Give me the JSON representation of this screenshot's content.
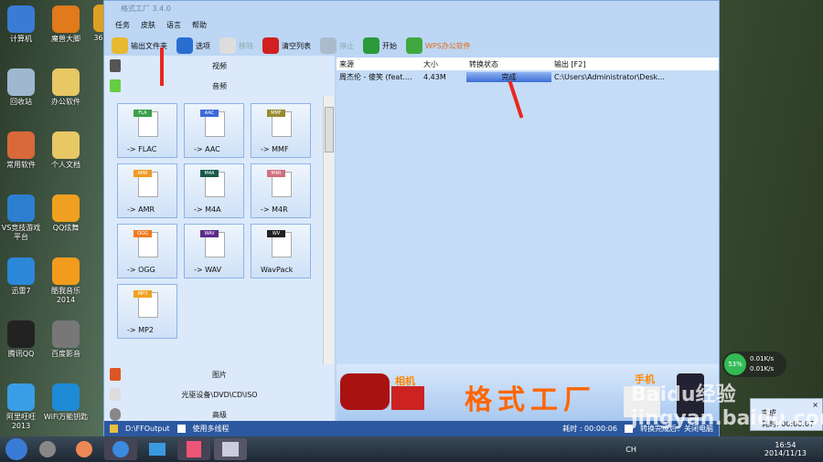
{
  "desktop": {
    "icons": [
      {
        "label": "计算机",
        "color": "#3a7bd5"
      },
      {
        "label": "魔兽大脚",
        "color": "#e07a1a"
      },
      {
        "label": "回收站",
        "color": "#9fb8d0"
      },
      {
        "label": "办公软件",
        "color": "#e8c765"
      },
      {
        "label": "常用软件",
        "color": "#d9683a"
      },
      {
        "label": "个人文档",
        "color": "#e8c765"
      },
      {
        "label": "VS竞技游戏平台",
        "color": "#2c7fcf"
      },
      {
        "label": "QQ炫舞",
        "color": "#f0a020"
      },
      {
        "label": "迅雷7",
        "color": "#2b87d8"
      },
      {
        "label": "酷我音乐2014",
        "color": "#f29b1d"
      },
      {
        "label": "腾讯QQ",
        "color": "#222222"
      },
      {
        "label": "百度影音",
        "color": "#777777"
      },
      {
        "label": "阿里旺旺2013",
        "color": "#3a9ee6"
      },
      {
        "label": "WiFi万能钥匙",
        "color": "#1e8bd6"
      }
    ],
    "partial_label": "360"
  },
  "window": {
    "title": "格式工厂 3.4.0",
    "menu": [
      "任务",
      "皮肤",
      "语言",
      "帮助"
    ],
    "toolbar": [
      {
        "label": "输出文件夹",
        "color": "#e8b830"
      },
      {
        "label": "选项",
        "color": "#2a6ed0"
      },
      {
        "label": "移除",
        "color": "#dddddd"
      },
      {
        "label": "清空列表",
        "color": "#d02020"
      },
      {
        "label": "停止",
        "color": "#aabbcc"
      },
      {
        "label": "开始",
        "color": "#2a9a3a"
      },
      {
        "label": "WPS办公软件",
        "color": "#3ea83e"
      }
    ],
    "categories_top": [
      "视频",
      "音频"
    ],
    "formats": [
      {
        "tag": "FLA",
        "label": "-> FLAC",
        "color": "#3aa04a"
      },
      {
        "tag": "AAC",
        "label": "-> AAC",
        "color": "#3a6ad8"
      },
      {
        "tag": "MMF",
        "label": "-> MMF",
        "color": "#9a8a30"
      },
      {
        "tag": "AMR",
        "label": "-> AMR",
        "color": "#f09a20"
      },
      {
        "tag": "M4A",
        "label": "-> M4A",
        "color": "#1a5a4a"
      },
      {
        "tag": "M4R",
        "label": "-> M4R",
        "color": "#d07080"
      },
      {
        "tag": "OGG",
        "label": "-> OGG",
        "color": "#f07a20"
      },
      {
        "tag": "WAV",
        "label": "-> WAV",
        "color": "#5a2a8a"
      },
      {
        "tag": "WV",
        "label": "WavPack",
        "color": "#222222"
      },
      {
        "tag": "MP3",
        "label": "-> MP2",
        "color": "#f0a020"
      }
    ],
    "categories_bottom": [
      "图片",
      "光驱设备\\DVD\\CD\\ISO",
      "高级"
    ],
    "table": {
      "headers": [
        "来源",
        "大小",
        "转换状态",
        "输出 [F2]"
      ],
      "rows": [
        {
          "source": "周杰伦 - 傻笑 (feat....",
          "size": "4.43M",
          "status": "完成",
          "output": "C:\\Users\\Administrator\\Desk..."
        }
      ]
    },
    "banner": {
      "title": "格式工厂",
      "camera": "相机",
      "phone": "手机"
    },
    "status": {
      "folder": "D:\\FFOutput",
      "multithread": "使用多线程",
      "elapsed": "耗时 : 00:00:06",
      "after": "转换完成后：关闭电脑"
    }
  },
  "widgets": {
    "cpu": "53%",
    "up": "0.01K/s",
    "down": "0.01K/s",
    "notify_title": "完成",
    "notify_time": "耗时: 00:00:07"
  },
  "watermark": "Baidu经验 jingyan.baidu.com",
  "tray": {
    "lang": "CH",
    "time": "16:54",
    "date": "2014/11/13"
  }
}
